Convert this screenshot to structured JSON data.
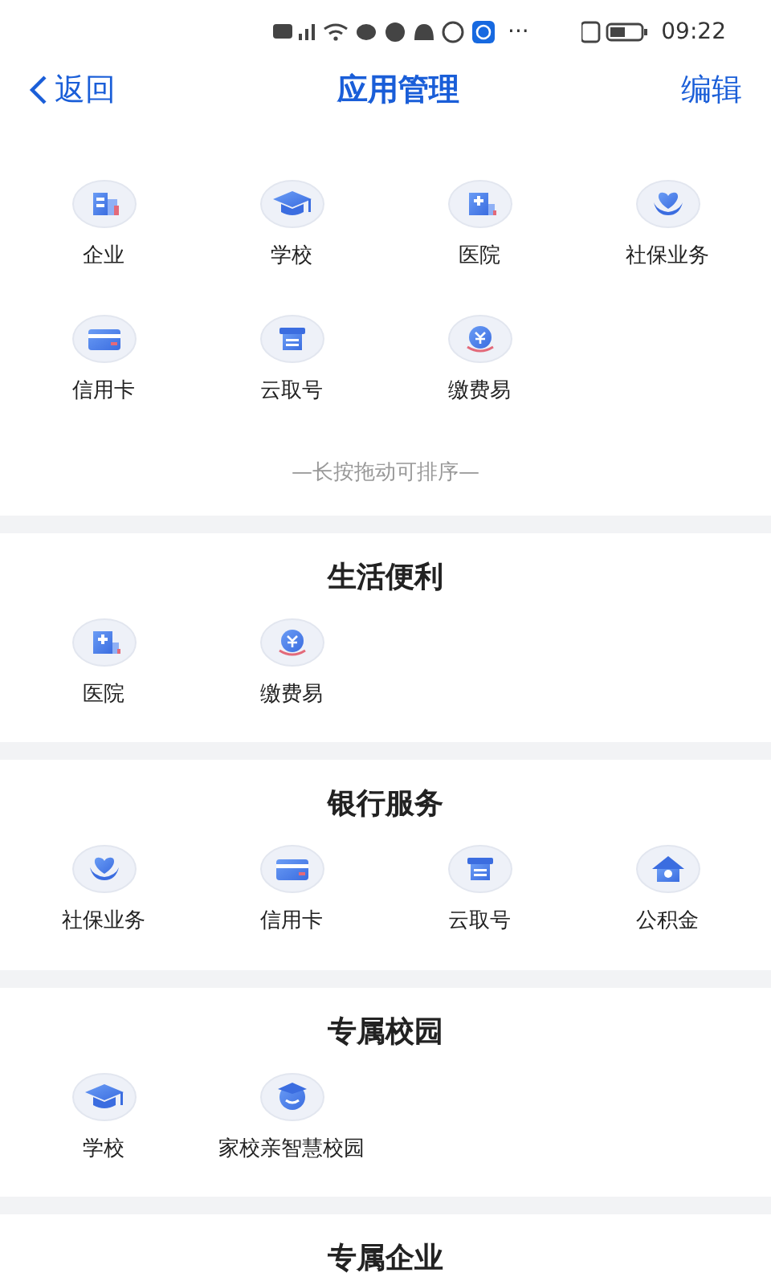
{
  "status_bar": {
    "time": "09:22",
    "more": "···"
  },
  "header": {
    "back": "返回",
    "title": "应用管理",
    "action": "编辑"
  },
  "my_apps": [
    {
      "label": "企业",
      "kind": "building"
    },
    {
      "label": "学校",
      "kind": "cap"
    },
    {
      "label": "医院",
      "kind": "hospital"
    },
    {
      "label": "社保业务",
      "kind": "heart"
    },
    {
      "label": "信用卡",
      "kind": "card"
    },
    {
      "label": "云取号",
      "kind": "ticket"
    },
    {
      "label": "缴费易",
      "kind": "coin"
    }
  ],
  "hint": "—长按拖动可排序—",
  "sections": [
    {
      "title": "生活便利",
      "items": [
        {
          "label": "医院",
          "kind": "hospital"
        },
        {
          "label": "缴费易",
          "kind": "coin"
        }
      ]
    },
    {
      "title": "银行服务",
      "items": [
        {
          "label": "社保业务",
          "kind": "heart"
        },
        {
          "label": "信用卡",
          "kind": "card"
        },
        {
          "label": "云取号",
          "kind": "ticket"
        },
        {
          "label": "公积金",
          "kind": "house"
        }
      ]
    },
    {
      "title": "专属校园",
      "items": [
        {
          "label": "学校",
          "kind": "cap"
        },
        {
          "label": "家校亲智慧校园",
          "kind": "face"
        }
      ]
    },
    {
      "title": "专属企业"
    }
  ]
}
